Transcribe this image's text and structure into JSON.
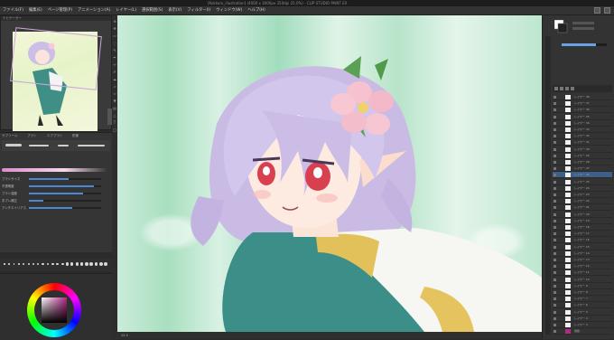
{
  "window": {
    "title": "[Kokkoro_illustration] (4000 x 3000px 350dpi 25.0%) - CLIP STUDIO PAINT EX"
  },
  "menu": {
    "items": [
      "ファイル(F)",
      "編集(E)",
      "ページ管理(P)",
      "アニメーション(A)",
      "レイヤー(L)",
      "選択範囲(S)",
      "表示(V)",
      "フィルター(I)",
      "ウィンドウ(W)",
      "ヘルプ(H)"
    ]
  },
  "navigator": {
    "header": "ナビゲーター"
  },
  "brush_panel": {
    "tabs": [
      "サブツール",
      "ブラシ",
      "エアブラシ",
      "鉛筆"
    ],
    "properties": [
      {
        "label": "ブラシサイズ",
        "value": 0.55
      },
      {
        "label": "不透明度",
        "value": 0.9
      },
      {
        "label": "ブラシ濃度",
        "value": 0.75
      },
      {
        "label": "手ブレ補正",
        "value": 0.2
      },
      {
        "label": "アンチエイリアス",
        "value": 0.6
      }
    ]
  },
  "color": {
    "accent": "#b02a86"
  },
  "canvas": {
    "status": "25.0"
  },
  "layers": {
    "rows": [
      {
        "name": "レイヤー 38"
      },
      {
        "name": "レイヤー 37"
      },
      {
        "name": "レイヤー 36"
      },
      {
        "name": "レイヤー 35"
      },
      {
        "name": "レイヤー 34"
      },
      {
        "name": "レイヤー 33"
      },
      {
        "name": "レイヤー 32"
      },
      {
        "name": "レイヤー 31"
      },
      {
        "name": "レイヤー 30"
      },
      {
        "name": "レイヤー 29"
      },
      {
        "name": "レイヤー 28"
      },
      {
        "name": "レイヤー 27"
      },
      {
        "name": "レイヤー 26"
      },
      {
        "name": "レイヤー 25"
      },
      {
        "name": "レイヤー 24"
      },
      {
        "name": "レイヤー 23"
      },
      {
        "name": "レイヤー 22"
      },
      {
        "name": "レイヤー 21"
      },
      {
        "name": "レイヤー 20"
      },
      {
        "name": "レイヤー 19"
      },
      {
        "name": "レイヤー 18"
      },
      {
        "name": "レイヤー 17"
      },
      {
        "name": "レイヤー 16"
      },
      {
        "name": "レイヤー 15"
      },
      {
        "name": "レイヤー 14"
      },
      {
        "name": "レイヤー 13"
      },
      {
        "name": "レイヤー 12"
      },
      {
        "name": "レイヤー 11"
      },
      {
        "name": "レイヤー 10"
      },
      {
        "name": "レイヤー 9"
      },
      {
        "name": "レイヤー 8"
      },
      {
        "name": "レイヤー 7"
      },
      {
        "name": "レイヤー 6"
      },
      {
        "name": "レイヤー 5"
      },
      {
        "name": "レイヤー 4"
      },
      {
        "name": "レイヤー 3"
      },
      {
        "name": "用紙"
      }
    ]
  }
}
